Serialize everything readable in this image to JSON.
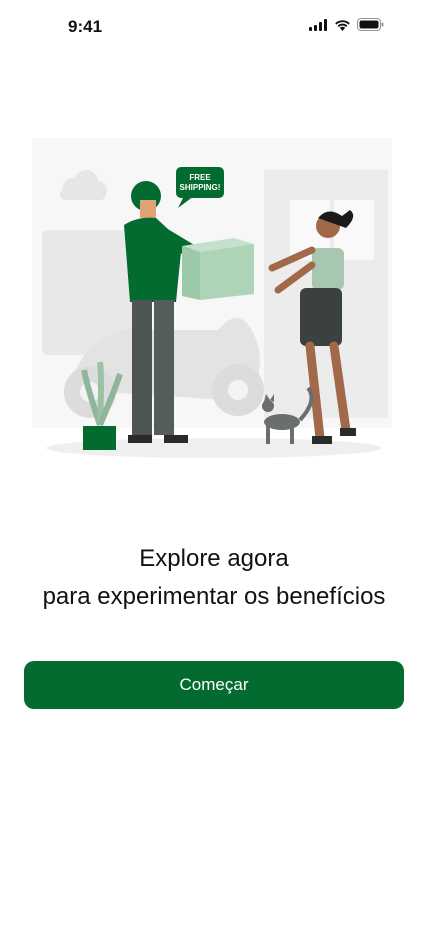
{
  "status_bar": {
    "time": "9:41",
    "icons": [
      "signal-icon",
      "wifi-icon",
      "battery-icon"
    ]
  },
  "illustration": {
    "speech_bubble_line1": "FREE",
    "speech_bubble_line2": "SHIPPING!"
  },
  "onboarding": {
    "headline_line1": "Explore agora",
    "headline_line2": "para experimentar os benefícios",
    "start_button_label": "Começar"
  },
  "colors": {
    "primary": "#036b2f",
    "background": "#ffffff",
    "text": "#111111"
  }
}
